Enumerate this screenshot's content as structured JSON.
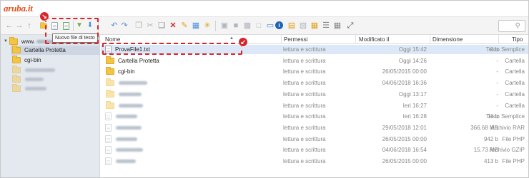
{
  "logo": {
    "text": "aruba.it"
  },
  "toolbar": {
    "new_text_file_tooltip": "Nuovo file di testo",
    "icons": [
      "arrow-left-icon",
      "arrow-right-icon",
      "arrow-up-icon",
      "new-folder-icon",
      "new-text-file-icon",
      "new-file-icon",
      "download-icon",
      "upload-icon",
      "undo-icon",
      "redo-icon",
      "copy-icon",
      "cut-icon",
      "paste-icon",
      "delete-icon",
      "rename-icon",
      "extract-icon",
      "star-icon",
      "preview-icon",
      "info-icon",
      "archive-icon",
      "list-view-icon",
      "grid-view-icon",
      "fullscreen-icon",
      "search-icon"
    ]
  },
  "sidebar": {
    "root_label": "www.",
    "items": [
      {
        "label": "Cartella Protetta",
        "selected": true
      },
      {
        "label": "cgi-bin",
        "selected": false
      },
      {
        "label": "",
        "selected": false
      },
      {
        "label": "",
        "selected": false
      },
      {
        "label": "",
        "selected": false
      }
    ]
  },
  "columns": {
    "name": "Nome",
    "permissions": "Permessi",
    "modified": "Modificato il",
    "size": "Dimensione",
    "type": "Tipo"
  },
  "files": [
    {
      "name": "ProvaFile1.txt",
      "kind": "file",
      "permissions": "lettura e scrittura",
      "modified": "Oggi 15:42",
      "size": "0 b",
      "type": "Testo Semplice",
      "selected": true
    },
    {
      "name": "Cartella Protetta",
      "kind": "folder",
      "permissions": "lettura e scrittura",
      "modified": "Oggi 14:26",
      "size": "-",
      "type": "Cartella",
      "selected": false
    },
    {
      "name": "cgi-bin",
      "kind": "folder",
      "permissions": "lettura e scrittura",
      "modified": "26/05/2015 00:00",
      "size": "-",
      "type": "Cartella",
      "selected": false
    },
    {
      "name": "",
      "kind": "folder",
      "permissions": "lettura e scrittura",
      "modified": "04/06/2018 16:36",
      "size": "-",
      "type": "Cartella",
      "selected": false
    },
    {
      "name": "",
      "kind": "folder",
      "permissions": "lettura e scrittura",
      "modified": "Oggi 13:17",
      "size": "-",
      "type": "Cartella",
      "selected": false
    },
    {
      "name": "",
      "kind": "folder",
      "permissions": "lettura e scrittura",
      "modified": "Ieri 16:27",
      "size": "-",
      "type": "Cartella",
      "selected": false
    },
    {
      "name": "",
      "kind": "file",
      "permissions": "lettura e scrittura",
      "modified": "Ieri 16:28",
      "size": "11 b",
      "type": "Testo Semplice",
      "selected": false
    },
    {
      "name": "",
      "kind": "file",
      "permissions": "lettura e scrittura",
      "modified": "29/05/2018 12:01",
      "size": "366.68 MB",
      "type": "Archivio RAR",
      "selected": false
    },
    {
      "name": "",
      "kind": "file",
      "permissions": "lettura e scrittura",
      "modified": "26/05/2015 00:00",
      "size": "942 b",
      "type": "File PHP",
      "selected": false
    },
    {
      "name": "",
      "kind": "file",
      "permissions": "lettura e scrittura",
      "modified": "04/06/2018 16:54",
      "size": "15.73 MB",
      "type": "Archivio GZIP",
      "selected": false
    },
    {
      "name": "",
      "kind": "file",
      "permissions": "lettura e scrittura",
      "modified": "26/05/2015 00:00",
      "size": "413 b",
      "type": "File PHP",
      "selected": false
    }
  ],
  "colors": {
    "accent": "#d6252b",
    "selection": "#dce8f7",
    "sidebar": "#e4e9ef",
    "folder": "#f4c542"
  }
}
